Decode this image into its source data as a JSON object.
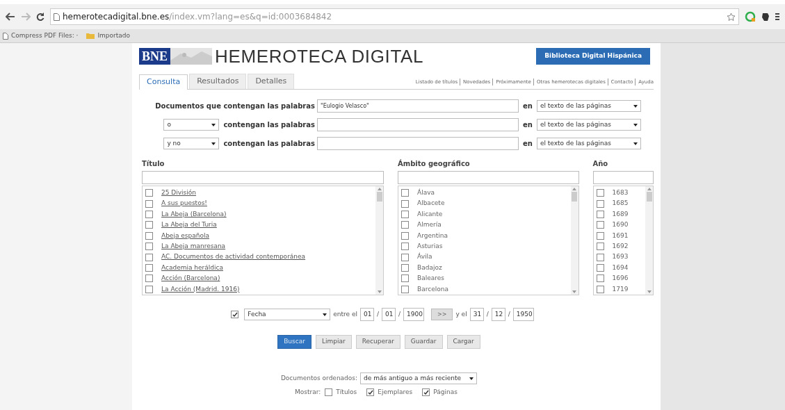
{
  "browser": {
    "url_host": "hemerotecadigital.bne.es",
    "url_path": "/index.vm?lang=es&q=id:0003684842",
    "bookmarks": [
      {
        "kind": "page",
        "label": "Compress PDF Files: ·"
      },
      {
        "kind": "folder",
        "label": "Importado"
      }
    ]
  },
  "header": {
    "logo": "BNE",
    "title": "HEMEROTECA DIGITAL",
    "library_button": "Biblioteca Digital Hispánica"
  },
  "tabs": [
    {
      "label": "Consulta",
      "selected": true
    },
    {
      "label": "Resultados",
      "selected": false
    },
    {
      "label": "Detalles",
      "selected": false
    }
  ],
  "top_links": [
    "Listado de títulos",
    "Novedades",
    "Próximamente",
    "Otras hemerotecas digitales",
    "Contacto",
    "Ayuda"
  ],
  "query_rows": [
    {
      "operator": null,
      "label": "Documentos que contengan las palabras",
      "value": "\"Eulogio Velasco\"",
      "in_label": "en",
      "scope": "el texto de las páginas"
    },
    {
      "operator": "o",
      "label": "contengan las palabras",
      "value": "",
      "in_label": "en",
      "scope": "el texto de las páginas"
    },
    {
      "operator": "y no",
      "label": "contengan las palabras",
      "value": "",
      "in_label": "en",
      "scope": "el texto de las páginas"
    }
  ],
  "filters": [
    {
      "kind": "link",
      "heading": "Título",
      "items": [
        {
          "label": "25 División",
          "checked": false
        },
        {
          "label": "A sus puestos!",
          "checked": false
        },
        {
          "label": "La Abeja (Barcelona)",
          "checked": false
        },
        {
          "label": "La Abeja del Turia",
          "checked": false
        },
        {
          "label": "Abeja española",
          "checked": false
        },
        {
          "label": "La Abeja manresana",
          "checked": false
        },
        {
          "label": "AC. Documentos de actividad contemporánea",
          "checked": false
        },
        {
          "label": "Academia heráldica",
          "checked": false
        },
        {
          "label": "Acción (Barcelona)",
          "checked": false
        },
        {
          "label": "La Acción (Madrid. 1916)",
          "checked": false
        }
      ]
    },
    {
      "kind": "plain",
      "heading": "Ámbito geográfico",
      "items": [
        {
          "label": "Álava",
          "checked": false
        },
        {
          "label": "Albacete",
          "checked": false
        },
        {
          "label": "Alicante",
          "checked": false
        },
        {
          "label": "Almería",
          "checked": false
        },
        {
          "label": "Argentina",
          "checked": false
        },
        {
          "label": "Asturias",
          "checked": false
        },
        {
          "label": "Ávila",
          "checked": false
        },
        {
          "label": "Badajoz",
          "checked": false
        },
        {
          "label": "Baleares",
          "checked": false
        },
        {
          "label": "Barcelona",
          "checked": false
        }
      ]
    },
    {
      "kind": "plain",
      "heading": "Año",
      "items": [
        {
          "label": "1683",
          "checked": false
        },
        {
          "label": "1685",
          "checked": false
        },
        {
          "label": "1689",
          "checked": false
        },
        {
          "label": "1690",
          "checked": false
        },
        {
          "label": "1691",
          "checked": false
        },
        {
          "label": "1692",
          "checked": false
        },
        {
          "label": "1693",
          "checked": false
        },
        {
          "label": "1694",
          "checked": false
        },
        {
          "label": "1696",
          "checked": false
        },
        {
          "label": "1719",
          "checked": false
        }
      ]
    }
  ],
  "date_filter": {
    "checked": true,
    "field": "Fecha",
    "between": "entre el",
    "from_day": "01",
    "from_month": "01",
    "from_year": "1900",
    "sep": "/",
    "copy_button": ">>",
    "and": "y el",
    "to_day": "31",
    "to_month": "12",
    "to_year": "1950"
  },
  "buttons": [
    {
      "label": "Buscar",
      "primary": true
    },
    {
      "label": "Limpiar",
      "primary": false
    },
    {
      "label": "Recuperar",
      "primary": false
    },
    {
      "label": "Guardar",
      "primary": false
    },
    {
      "label": "Cargar",
      "primary": false
    }
  ],
  "sort": {
    "label": "Documentos ordenados:",
    "value": "de más antiguo a más reciente"
  },
  "show": {
    "label": "Mostrar:",
    "options": [
      {
        "label": "Títulos",
        "checked": false
      },
      {
        "label": "Ejemplares",
        "checked": true
      },
      {
        "label": "Páginas",
        "checked": true
      }
    ]
  }
}
